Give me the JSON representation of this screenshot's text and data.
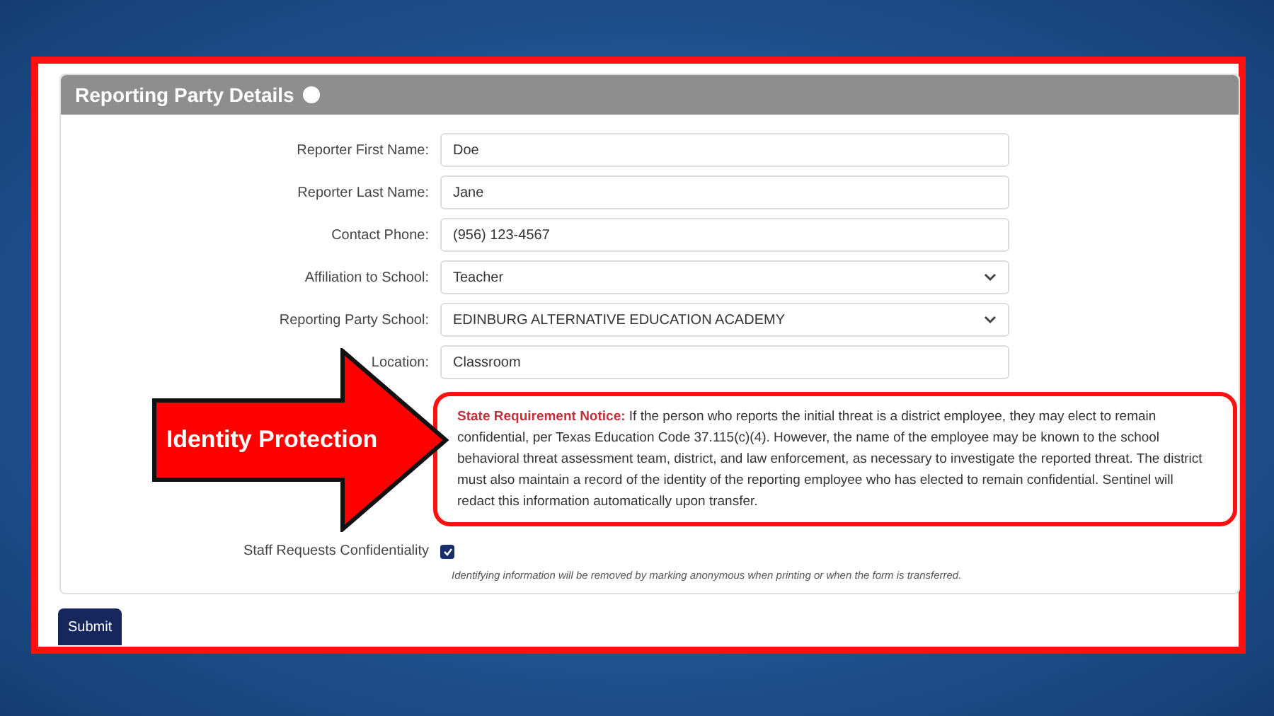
{
  "panel": {
    "title": "Reporting Party Details"
  },
  "fields": [
    {
      "label": "Reporter First Name:",
      "value": "Doe",
      "kind": "input"
    },
    {
      "label": "Reporter Last Name:",
      "value": "Jane",
      "kind": "input"
    },
    {
      "label": "Contact Phone:",
      "value": "(956) 123-4567",
      "kind": "input"
    },
    {
      "label": "Affiliation to School:",
      "value": "Teacher",
      "kind": "select"
    },
    {
      "label": "Reporting Party School:",
      "value": "EDINBURG ALTERNATIVE EDUCATION ACADEMY",
      "kind": "select"
    },
    {
      "label": "Location:",
      "value": "Classroom",
      "kind": "input"
    }
  ],
  "notice": "**State Requirement Notice:** If the person who reports the initial threat is a district employee, they may elect to remain confidential, per Texas Education Code 37.115(c)(4). However, the name of the employee may be known to the school behavioral threat assessment team, district, and law enforcement, as necessary to investigate the reported threat. The district must also maintain a record of the identity of the reporting employee who has elected to remain confidential. Sentinel will redact this information automatically upon transfer.",
  "confidentiality": {
    "label": "Staff Requests Confidentiality",
    "checked": true,
    "hint": "Identifying information will be removed by marking anonymous when printing or when the form is transferred."
  },
  "submit": "Submit",
  "callout": {
    "label": "Identity Protection"
  }
}
